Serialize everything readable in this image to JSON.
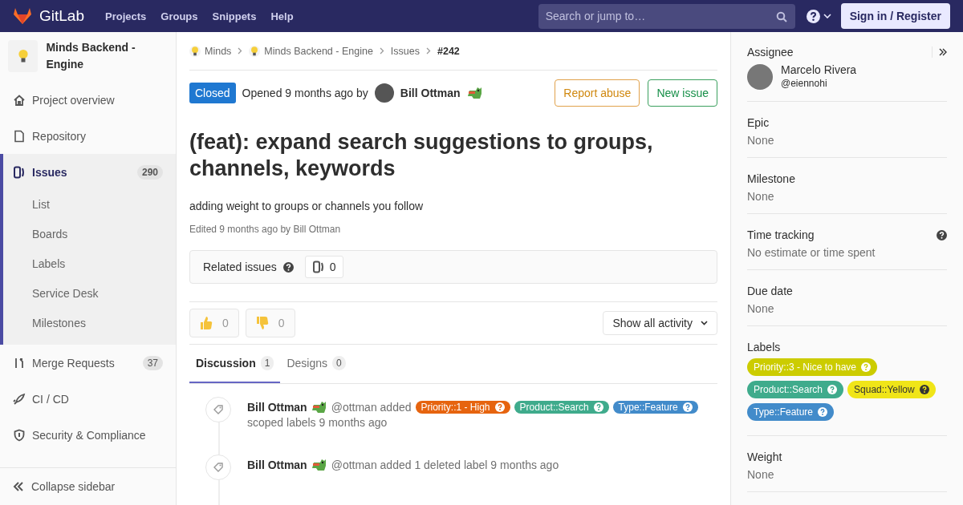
{
  "navbar": {
    "brand": "GitLab",
    "links": [
      "Projects",
      "Groups",
      "Snippets",
      "Help"
    ],
    "search": {
      "placeholder": "Search or jump to…"
    },
    "sign_in": "Sign in / Register"
  },
  "sidebar": {
    "project_name": "Minds Backend - Engine",
    "items": [
      {
        "label": "Project overview",
        "kind": "home",
        "selected": false
      },
      {
        "label": "Repository",
        "kind": "doc",
        "selected": false
      },
      {
        "label": "Issues",
        "kind": "issues",
        "count": "290",
        "selected": true,
        "children": [
          {
            "label": "List",
            "selected": false
          },
          {
            "label": "Boards",
            "selected": false
          },
          {
            "label": "Labels",
            "selected": false
          },
          {
            "label": "Service Desk",
            "selected": false
          },
          {
            "label": "Milestones",
            "selected": false
          }
        ]
      },
      {
        "label": "Merge Requests",
        "kind": "merge",
        "count": "37",
        "selected": false
      },
      {
        "label": "CI / CD",
        "kind": "rocket",
        "selected": false
      },
      {
        "label": "Security & Compliance",
        "kind": "shield",
        "selected": false
      }
    ],
    "collapse": "Collapse sidebar"
  },
  "breadcrumbs": [
    {
      "label": "Minds",
      "kind": "group"
    },
    {
      "label": "Minds Backend - Engine",
      "kind": "group"
    },
    {
      "label": "Issues",
      "kind": "link"
    },
    {
      "label": "#242",
      "kind": "current"
    }
  ],
  "issue": {
    "status": "Closed",
    "opened": "Opened 9 months ago by",
    "author": "Bill Ottman",
    "buttons": [
      {
        "label": "Report abuse",
        "kind": "warning"
      },
      {
        "label": "New issue",
        "kind": "success"
      }
    ],
    "title": "(feat): expand search suggestions to groups, channels, keywords",
    "description": "adding weight to groups or channels you follow",
    "edited": "Edited 9 months ago by Bill Ottman"
  },
  "related": {
    "label": "Related issues",
    "count": "0"
  },
  "awards": [
    {
      "kind": "thumbsup",
      "count": "0"
    },
    {
      "kind": "thumbsdown",
      "count": "0"
    }
  ],
  "activity_filter": "Show all activity",
  "tabs": [
    {
      "label": "Discussion",
      "count": "1",
      "selected": true
    },
    {
      "label": "Designs",
      "count": "0",
      "selected": false
    }
  ],
  "activity": [
    {
      "author": "Bill Ottman",
      "text": "@ottman added",
      "labels": [
        {
          "label": "Priority::1 - High",
          "color": "#e6640f"
        },
        {
          "label": "Product::Search",
          "color": "#3fab8c"
        },
        {
          "label": "Type::Feature",
          "color": "#428bca"
        }
      ],
      "after": "scoped labels 9 months ago"
    },
    {
      "author": "Bill Ottman",
      "text": "@ottman added 1 deleted label 9 months ago"
    }
  ],
  "right_sidebar": {
    "assignee": {
      "heading": "Assignee",
      "name": "Marcelo Rivera",
      "username": "@eiennohi"
    },
    "sections": [
      {
        "kind": "value",
        "heading": "Epic",
        "value": "None"
      },
      {
        "kind": "value",
        "heading": "Milestone",
        "value": "None"
      },
      {
        "kind": "help",
        "heading": "Time tracking",
        "value": "No estimate or time spent"
      },
      {
        "kind": "value",
        "heading": "Due date",
        "value": "None"
      },
      {
        "kind": "labels",
        "heading": "Labels",
        "labels": [
          {
            "label": "Priority::3 - Nice to have",
            "color": "#cccc00"
          },
          {
            "label": "Product::Search",
            "color": "#3fab8c"
          },
          {
            "label": "Squad::Yellow",
            "color": "#f0e518"
          },
          {
            "label": "Type::Feature",
            "color": "#428bca"
          }
        ]
      },
      {
        "kind": "value",
        "heading": "Weight",
        "value": "None"
      }
    ]
  }
}
